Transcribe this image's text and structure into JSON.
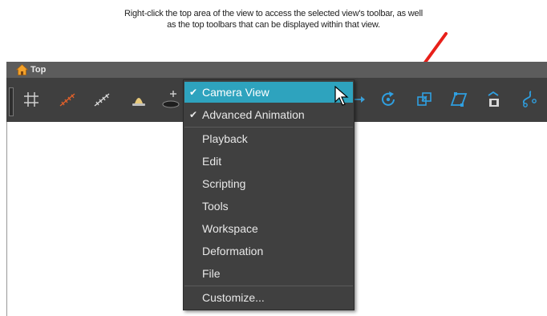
{
  "caption": {
    "line1": "Right-click the top area of the view to access the selected view's toolbar, as well",
    "line2": "as the top toolbars that can be displayed within that view."
  },
  "view": {
    "title": "Top",
    "icon": "home-icon"
  },
  "toolbar": {
    "icons": [
      "grid-icon",
      "onion-skin-red-icon",
      "onion-skin-white-icon",
      "light-table-icon",
      "add-drawing-icon",
      "motion-path-icon",
      "rotate-icon",
      "scale-icon",
      "skew-icon",
      "flip-icon",
      "morph-icon"
    ]
  },
  "context_menu": {
    "items": [
      {
        "label": "Camera View",
        "checked": true,
        "highlighted": true
      },
      {
        "label": "Advanced Animation",
        "checked": true,
        "highlighted": false
      },
      {
        "label": "Playback",
        "checked": false,
        "highlighted": false
      },
      {
        "label": "Edit",
        "checked": false,
        "highlighted": false
      },
      {
        "label": "Scripting",
        "checked": false,
        "highlighted": false
      },
      {
        "label": "Tools",
        "checked": false,
        "highlighted": false
      },
      {
        "label": "Workspace",
        "checked": false,
        "highlighted": false
      },
      {
        "label": "Deformation",
        "checked": false,
        "highlighted": false
      },
      {
        "label": "File",
        "checked": false,
        "highlighted": false
      },
      {
        "label": "Customize...",
        "checked": false,
        "highlighted": false
      }
    ],
    "check_glyph": "✔"
  },
  "colors": {
    "highlight": "#2ea3be",
    "annotation_arrow": "#e8201a",
    "toolbar_bg": "#3f3f3f",
    "titlebar_bg": "#5c5c5c"
  }
}
